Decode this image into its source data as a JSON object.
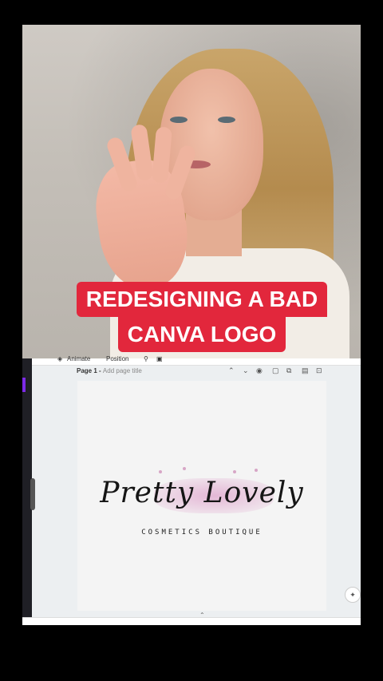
{
  "video": {
    "caption_line1": "REDESIGNING A BAD",
    "caption_line2": "CANVA LOGO",
    "caption_color": "#e2273c"
  },
  "canva": {
    "toolbar": {
      "animate_label": "Animate",
      "position_label": "Position"
    },
    "page": {
      "page_label": "Page 1 - ",
      "title_placeholder": "Add page title"
    },
    "page_icons": [
      "chevron-up-icon",
      "chevron-down-icon",
      "eye-icon",
      "lock-icon",
      "duplicate-icon",
      "trash-icon",
      "add-page-icon"
    ],
    "logo": {
      "title": "Pretty Lovely",
      "subtitle": "COSMETICS BOUTIQUE",
      "accent_color": "#e2b0d2"
    }
  }
}
